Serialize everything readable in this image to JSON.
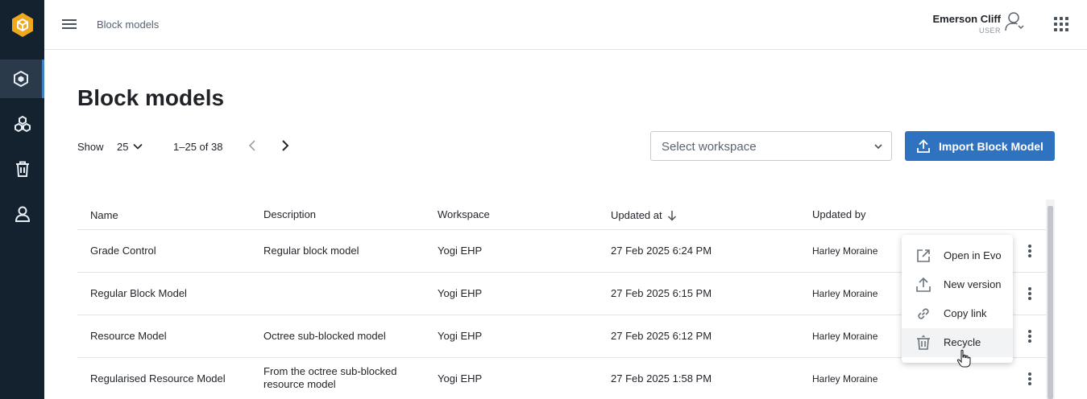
{
  "topbar": {
    "breadcrumb": "Block models",
    "user_name": "Emerson Cliff",
    "user_role": "USER"
  },
  "sidebar": {
    "items": [
      {
        "icon": "block-model-icon",
        "active": true
      },
      {
        "icon": "cubes-icon",
        "active": false
      },
      {
        "icon": "trash-icon",
        "active": false
      },
      {
        "icon": "person-icon",
        "active": false
      }
    ]
  },
  "page": {
    "title": "Block models",
    "show_label": "Show",
    "page_size": "25",
    "range": "1–25 of 38",
    "workspace_placeholder": "Select workspace",
    "import_label": "Import Block Model"
  },
  "table": {
    "headers": [
      "Name",
      "Description",
      "Workspace",
      "Updated at",
      "Updated by"
    ],
    "rows": [
      {
        "name": "Grade Control",
        "description": "Regular block model",
        "workspace": "Yogi EHP",
        "updated_at": "27 Feb 2025 6:24 PM",
        "updated_by": "Harley Moraine"
      },
      {
        "name": "Regular Block Model",
        "description": "",
        "workspace": "Yogi EHP",
        "updated_at": "27 Feb 2025 6:15 PM",
        "updated_by": "Harley Moraine"
      },
      {
        "name": "Resource Model",
        "description": "Octree sub-blocked model",
        "workspace": "Yogi EHP",
        "updated_at": "27 Feb 2025 6:12 PM",
        "updated_by": "Harley Moraine"
      },
      {
        "name": "Regularised Resource Model",
        "description": "From the octree sub-blocked resource model",
        "workspace": "Yogi EHP",
        "updated_at": "27 Feb 2025 1:58 PM",
        "updated_by": "Harley Moraine"
      }
    ]
  },
  "menu": {
    "items": [
      {
        "label": "Open in Evo",
        "icon": "open-external-icon"
      },
      {
        "label": "New version",
        "icon": "upload-icon"
      },
      {
        "label": "Copy link",
        "icon": "link-icon"
      },
      {
        "label": "Recycle",
        "icon": "recycle-bin-icon"
      }
    ]
  },
  "colors": {
    "sidebar_bg": "#14212e",
    "accent": "#2f73c0",
    "logo": "#f0a81c"
  }
}
